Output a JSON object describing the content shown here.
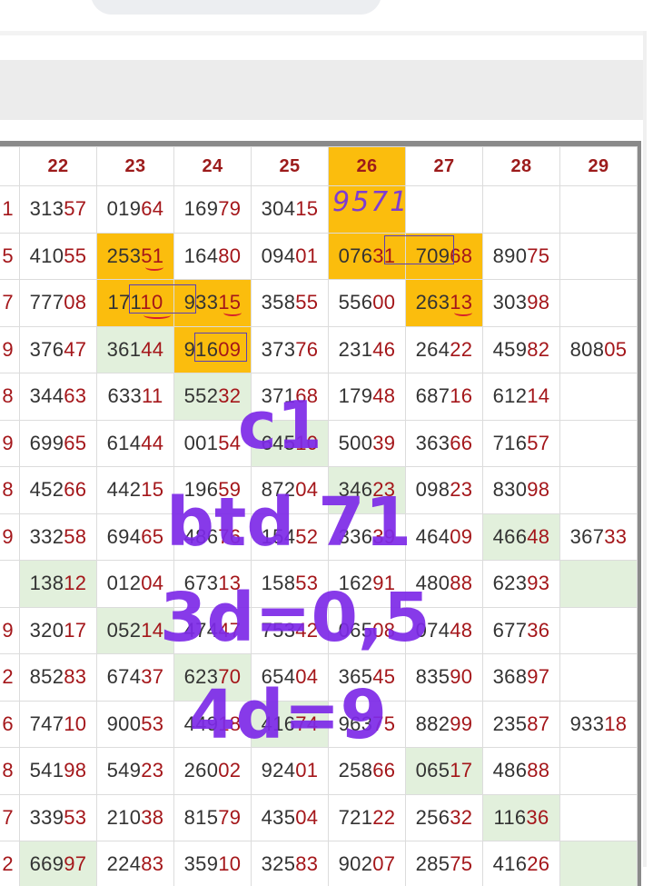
{
  "columns": [
    "22",
    "23",
    "24",
    "25",
    "26",
    "27",
    "28",
    "29"
  ],
  "rows": [
    {
      "first": "1",
      "cells": [
        "31357",
        "01964",
        "16979",
        "30415",
        "",
        "",
        "",
        ""
      ]
    },
    {
      "first": "5",
      "cells": [
        "41055",
        "25351",
        "16480",
        "09401",
        "07631",
        "70968",
        "89075",
        ""
      ]
    },
    {
      "first": "7",
      "cells": [
        "77708",
        "17110",
        "93315",
        "35855",
        "55600",
        "26313",
        "30398",
        ""
      ]
    },
    {
      "first": "9",
      "cells": [
        "37647",
        "36144",
        "91609",
        "37376",
        "23146",
        "26422",
        "45982",
        "80805"
      ]
    },
    {
      "first": "8",
      "cells": [
        "34463",
        "63311",
        "55232",
        "37168",
        "17948",
        "68716",
        "61214",
        ""
      ]
    },
    {
      "first": "9",
      "cells": [
        "69965",
        "61444",
        "00154",
        "64510",
        "50039",
        "36366",
        "71657",
        ""
      ]
    },
    {
      "first": "8",
      "cells": [
        "45266",
        "44215",
        "19659",
        "87204",
        "34623",
        "09823",
        "83098",
        ""
      ]
    },
    {
      "first": "9",
      "cells": [
        "33258",
        "69465",
        "48676",
        "15452",
        "33639",
        "46409",
        "46648",
        "36733"
      ]
    },
    {
      "first": "",
      "cells": [
        "13812",
        "01204",
        "67313",
        "15853",
        "16291",
        "48088",
        "62393",
        ""
      ]
    },
    {
      "first": "9",
      "cells": [
        "32017",
        "05214",
        "47447",
        "75342",
        "06508",
        "07448",
        "67736",
        ""
      ]
    },
    {
      "first": "2",
      "cells": [
        "85283",
        "67437",
        "62370",
        "65404",
        "36545",
        "83590",
        "36897",
        ""
      ]
    },
    {
      "first": "6",
      "cells": [
        "74710",
        "90053",
        "44918",
        "41674",
        "96375",
        "88299",
        "23587",
        "93318"
      ]
    },
    {
      "first": "8",
      "cells": [
        "54198",
        "54923",
        "26002",
        "92401",
        "25866",
        "06517",
        "48688",
        ""
      ]
    },
    {
      "first": "7",
      "cells": [
        "33953",
        "21038",
        "81579",
        "43504",
        "72122",
        "25632",
        "11636",
        ""
      ]
    },
    {
      "first": "2",
      "cells": [
        "66997",
        "22483",
        "35910",
        "32583",
        "90207",
        "28575",
        "41626",
        ""
      ]
    }
  ],
  "highlights": {
    "orange": [
      "r1c1",
      "r2c1",
      "r2c2",
      "r3c2",
      "r0c4",
      "r1c4",
      "r1c5",
      "r2c5"
    ],
    "green": [
      "r3c1",
      "r4c2",
      "r5c3",
      "r6c4",
      "r7c6",
      "r8c0",
      "r8c7",
      "r9c1",
      "r10c2",
      "r11c3",
      "r12c5",
      "r13c6",
      "r14c0",
      "r14c7"
    ]
  },
  "colors": {
    "orange": "#fbbd0d",
    "green": "#e2f0dc",
    "annotation": "#7d2ae8",
    "number_dark": "#333333",
    "number_red": "#a4161a"
  },
  "handwritten": {
    "number": "9571"
  },
  "annotations": {
    "line1": "c1",
    "line2": "btd 71",
    "line3": "3d=0,5",
    "line4": "4d=9"
  }
}
